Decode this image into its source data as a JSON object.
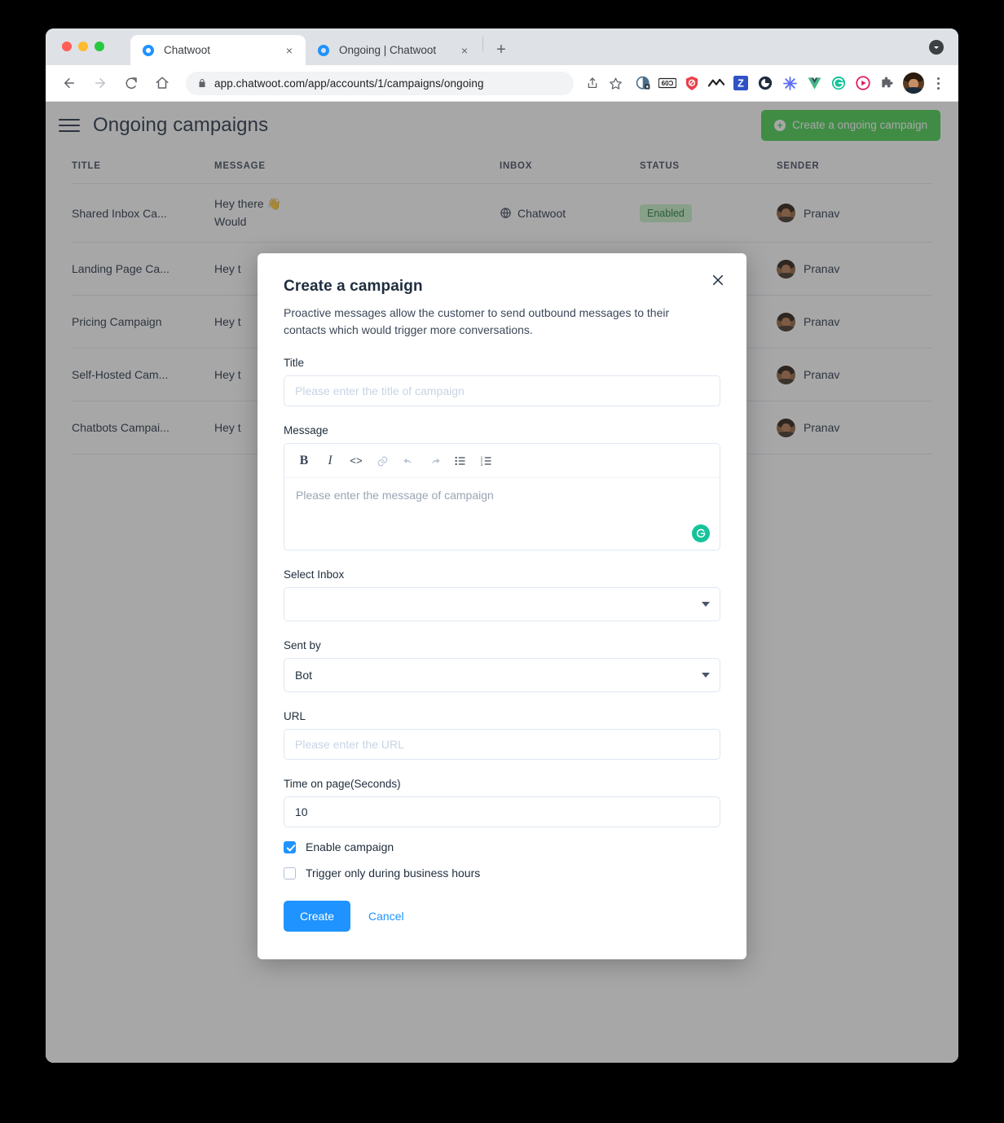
{
  "browser": {
    "tabs": [
      {
        "title": "Chatwoot",
        "favicon": "chatwoot-favicon",
        "active": true,
        "close_label": "×"
      },
      {
        "title": "Ongoing | Chatwoot",
        "favicon": "chatwoot-favicon",
        "active": false,
        "close_label": "×"
      }
    ],
    "new_tab_label": "+",
    "url_secure_prefix": "app.chatwoot.com",
    "url_path": "/app/accounts/1/campaigns/ongoing",
    "url_full": "app.chatwoot.com/app/accounts/1/campaigns/ongoing",
    "extensions": [
      {
        "name": "share-icon",
        "glyph": "⇧"
      },
      {
        "name": "bookmark-star-icon",
        "glyph": "☆"
      },
      {
        "name": "extension-privacy-badger-icon",
        "glyph": ""
      },
      {
        "name": "extension-goo-icon",
        "glyph": "60ɔ"
      },
      {
        "name": "extension-adblock-shield-icon",
        "glyph": ""
      },
      {
        "name": "extension-mm-icon",
        "glyph": ""
      },
      {
        "name": "extension-zotero-icon",
        "glyph": "Z"
      },
      {
        "name": "extension-clockify-icon",
        "glyph": ""
      },
      {
        "name": "extension-asterisk-icon",
        "glyph": "✻"
      },
      {
        "name": "extension-vue-devtools-icon",
        "glyph": "V"
      },
      {
        "name": "extension-grammarly-icon",
        "glyph": "G"
      },
      {
        "name": "extension-loom-icon",
        "glyph": "▶"
      },
      {
        "name": "extensions-puzzle-icon",
        "glyph": ""
      }
    ],
    "menu_label": "⋮"
  },
  "app": {
    "page_title": "Ongoing campaigns",
    "create_button_label": "Create a ongoing campaign",
    "create_button_icon": "plus-circle-icon",
    "menu_icon": "hamburger-icon",
    "accent_green": "#44ce4b"
  },
  "table": {
    "columns": [
      "TITLE",
      "MESSAGE",
      "INBOX",
      "STATUS",
      "SENDER"
    ],
    "rows": [
      {
        "title": "Shared Inbox Ca...",
        "message": "Hey there 👋\nWould",
        "inbox": "Chatwoot",
        "status": "Enabled",
        "sender": "Pranav"
      },
      {
        "title": "Landing Page Ca...",
        "message": "Hey t",
        "inbox": "",
        "status": "",
        "sender": "Pranav"
      },
      {
        "title": "Pricing Campaign",
        "message": "Hey t",
        "inbox": "",
        "status": "",
        "sender": "Pranav"
      },
      {
        "title": "Self-Hosted Cam...",
        "message": "Hey t",
        "inbox": "",
        "status": "",
        "sender": "Pranav"
      },
      {
        "title": "Chatbots Campai...",
        "message": "Hey t",
        "inbox": "",
        "status": "",
        "sender": "Pranav"
      }
    ]
  },
  "modal": {
    "title": "Create a campaign",
    "description": "Proactive messages allow the customer to send outbound messages to their contacts which would trigger more conversations.",
    "close_icon": "close-icon",
    "fields": {
      "title": {
        "label": "Title",
        "value": "",
        "placeholder": "Please enter the title of campaign"
      },
      "message": {
        "label": "Message",
        "value": "",
        "placeholder": "Please enter the message of campaign",
        "toolbar": [
          {
            "name": "bold-icon",
            "glyph": "B"
          },
          {
            "name": "italic-icon",
            "glyph": "I"
          },
          {
            "name": "code-icon",
            "glyph": "<>"
          },
          {
            "name": "link-icon",
            "glyph": ""
          },
          {
            "name": "undo-icon",
            "glyph": ""
          },
          {
            "name": "redo-icon",
            "glyph": ""
          },
          {
            "name": "bullet-list-icon",
            "glyph": ""
          },
          {
            "name": "numbered-list-icon",
            "glyph": ""
          }
        ],
        "grammarly_icon": "grammarly-icon"
      },
      "select_inbox": {
        "label": "Select Inbox",
        "value": ""
      },
      "sent_by": {
        "label": "Sent by",
        "value": "Bot"
      },
      "url": {
        "label": "URL",
        "value": "",
        "placeholder": "Please enter the URL"
      },
      "time_on_page": {
        "label": "Time on page(Seconds)",
        "value": "10"
      }
    },
    "checkboxes": [
      {
        "label": "Enable campaign",
        "checked": true
      },
      {
        "label": "Trigger only during business hours",
        "checked": false
      }
    ],
    "actions": {
      "submit_label": "Create",
      "cancel_label": "Cancel",
      "submit_color": "#1f93ff"
    }
  }
}
